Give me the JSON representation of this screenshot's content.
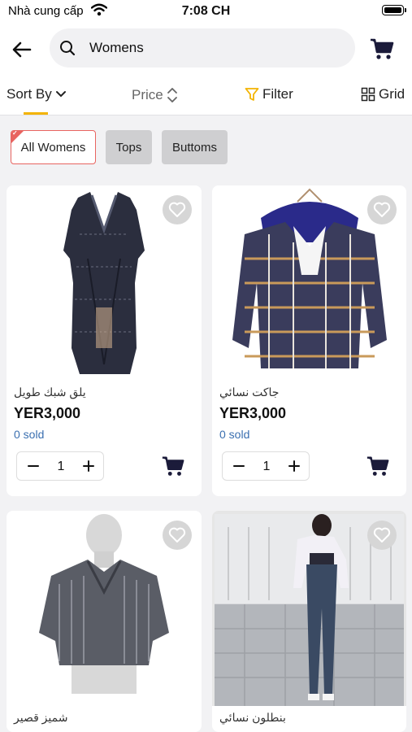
{
  "status_bar": {
    "carrier": "Nhà cung cấp",
    "time": "7:08 CH"
  },
  "search": {
    "value": "Womens",
    "placeholder": "Search"
  },
  "toolbar": {
    "sort_label": "Sort By",
    "price_label": "Price",
    "filter_label": "Filter",
    "grid_label": "Grid"
  },
  "chips": [
    {
      "label": "All Womens",
      "selected": true
    },
    {
      "label": "Tops",
      "selected": false
    },
    {
      "label": "Buttoms",
      "selected": false
    }
  ],
  "products": [
    {
      "name": "يلق شبك طويل",
      "price": "YER3,000",
      "sold": "0 sold",
      "qty": "1",
      "image_icon": "lace-dress-image"
    },
    {
      "name": "جاكت نسائي",
      "price": "YER3,000",
      "sold": "0 sold",
      "qty": "1",
      "image_icon": "plaid-jacket-image"
    },
    {
      "name": "شميز قصير",
      "image_icon": "striped-shirt-image"
    },
    {
      "name": "بنطلون نسائي",
      "image_icon": "jeans-outfit-image"
    }
  ],
  "colors": {
    "accent_underline": "#f3b300",
    "filter_icon": "#f3b300",
    "chip_selected_border": "#e86460",
    "sold_text": "#3a6fb0",
    "cart_icon": "#1b1b3a"
  }
}
